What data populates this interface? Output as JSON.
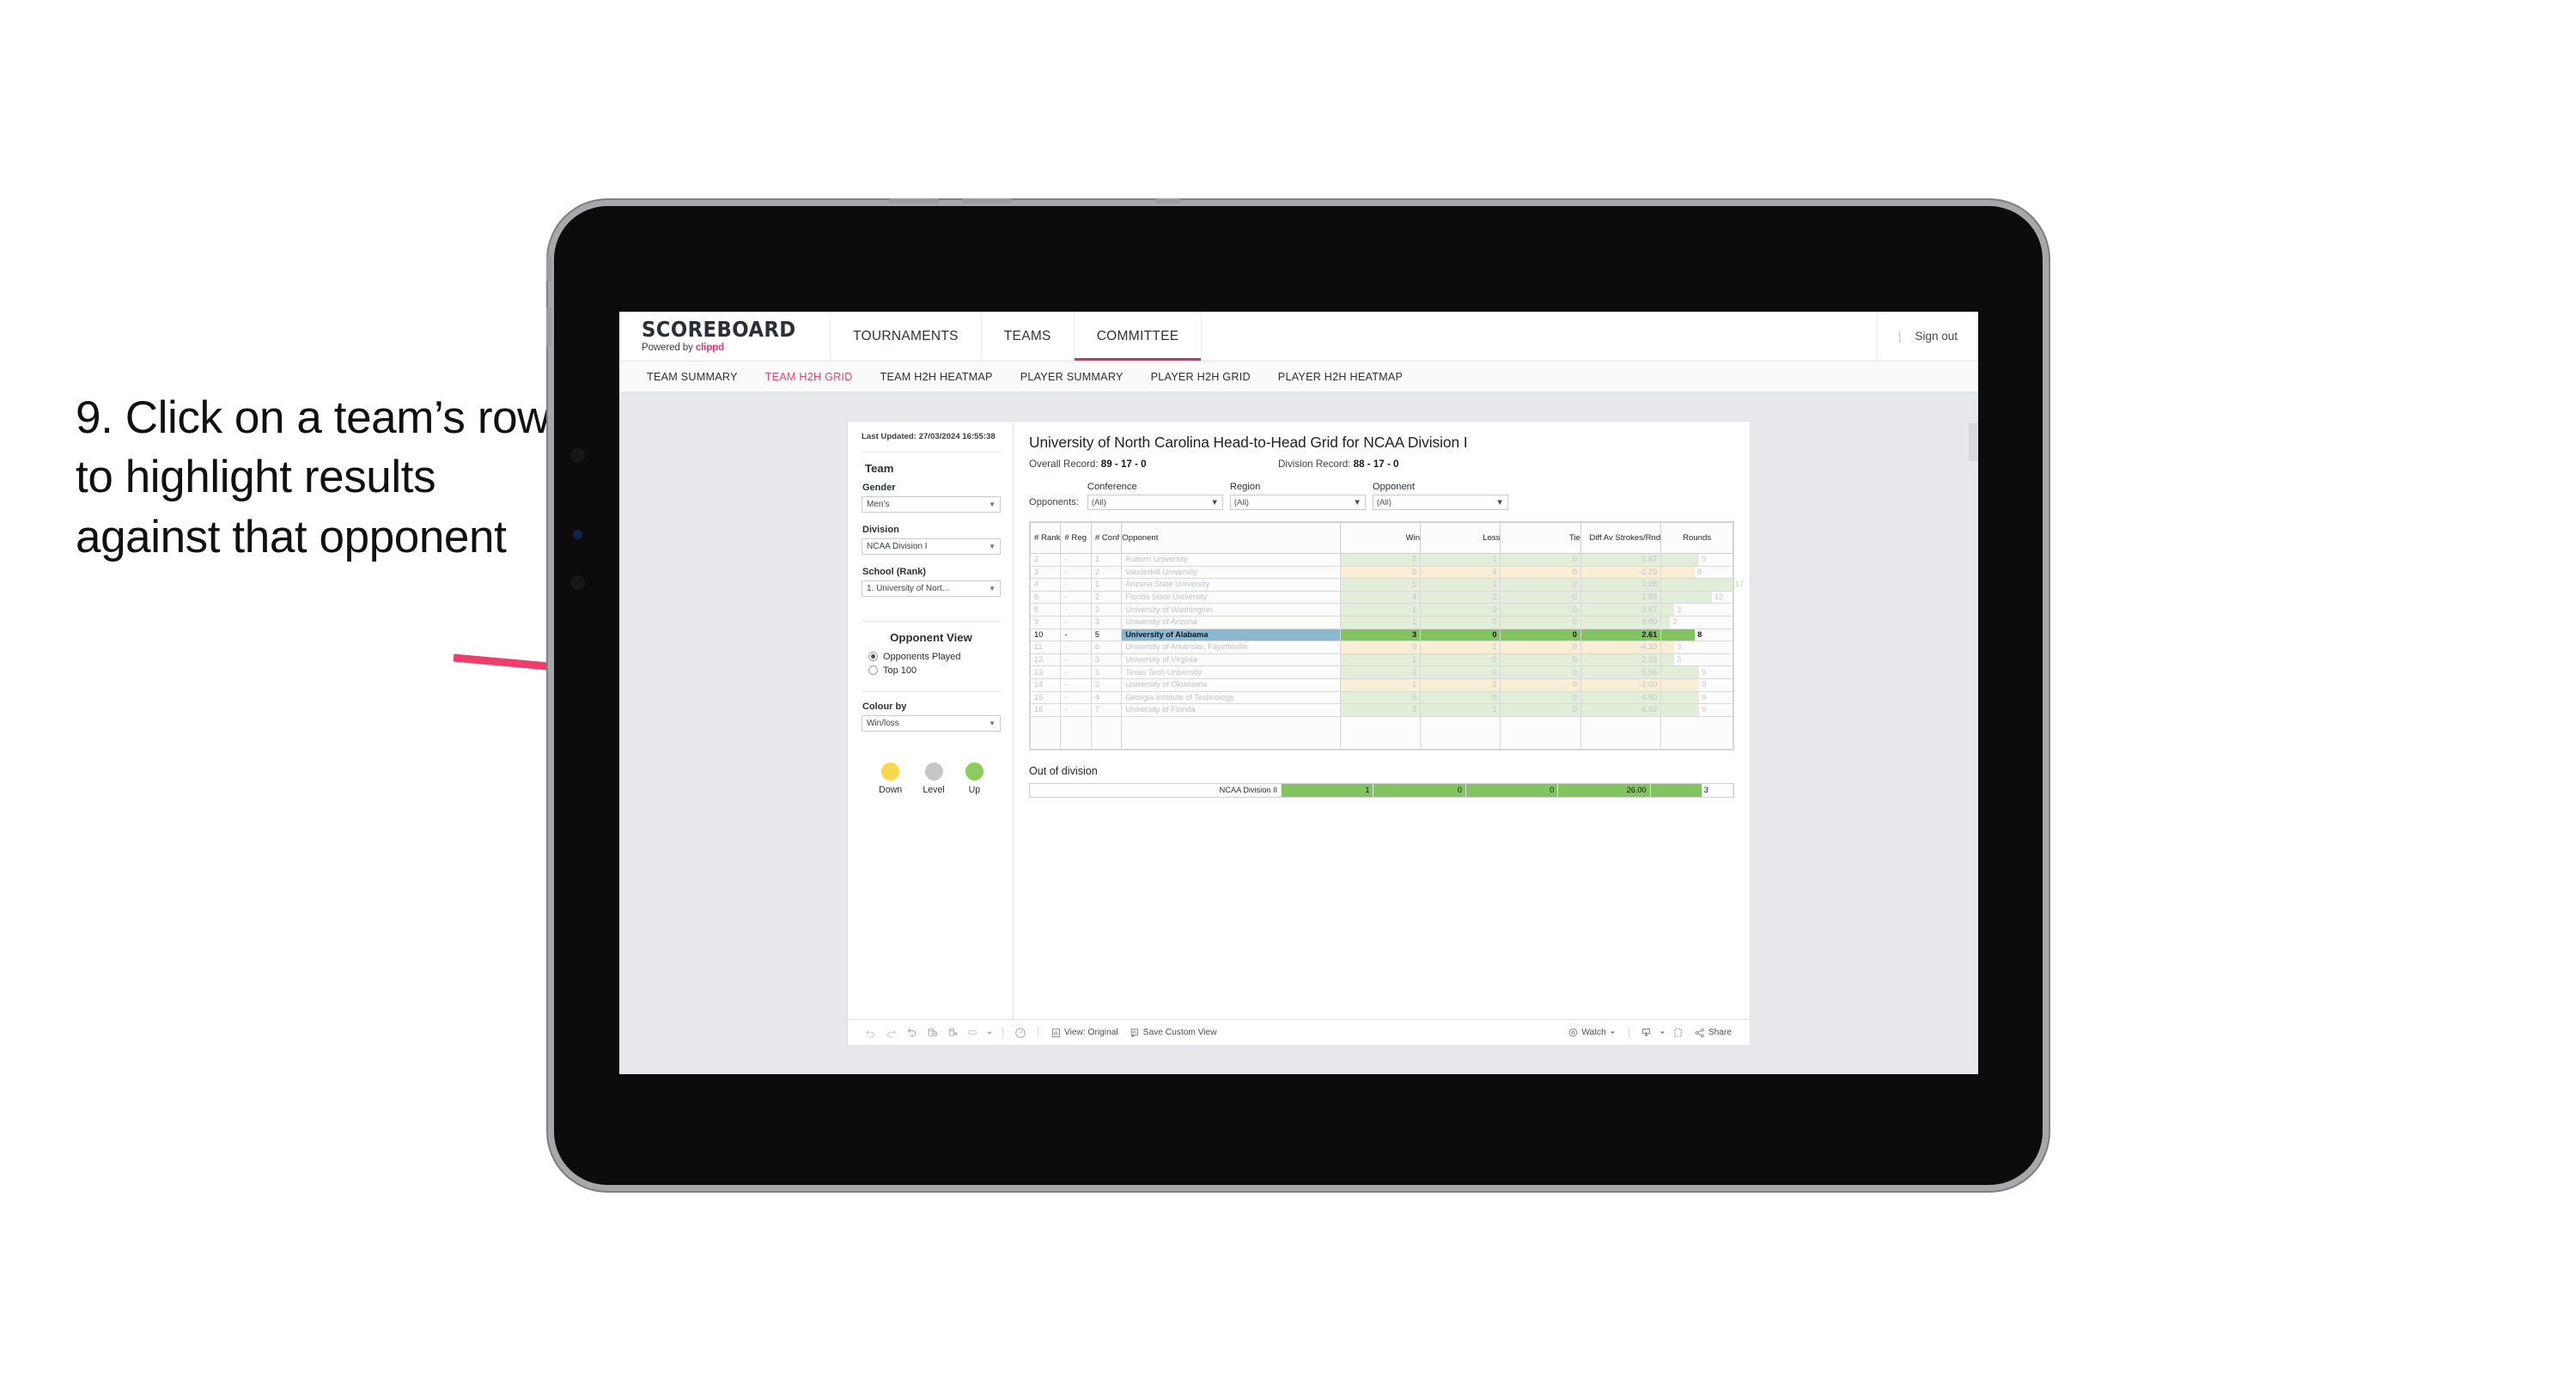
{
  "annotation": {
    "text": "9. Click on a team’s row to highlight results against that opponent",
    "arrow_color": "#ef3e69"
  },
  "header": {
    "brand_title": "SCOREBOARD",
    "brand_sub_prefix": "Powered by ",
    "brand_sub_name": "clippd",
    "nav": [
      {
        "label": "TOURNAMENTS",
        "active": false
      },
      {
        "label": "TEAMS",
        "active": false
      },
      {
        "label": "COMMITTEE",
        "active": true
      }
    ],
    "separator": "|",
    "sign_out": "Sign out"
  },
  "subnav": {
    "tabs": [
      {
        "label": "TEAM SUMMARY",
        "active": false
      },
      {
        "label": "TEAM H2H GRID",
        "active": true
      },
      {
        "label": "TEAM H2H HEATMAP",
        "active": false
      },
      {
        "label": "PLAYER SUMMARY",
        "active": false
      },
      {
        "label": "PLAYER H2H GRID",
        "active": false
      },
      {
        "label": "PLAYER H2H HEATMAP",
        "active": false
      }
    ]
  },
  "sidebar": {
    "last_updated": "Last Updated: 27/03/2024 16:55:38",
    "team_heading": "Team",
    "gender_label": "Gender",
    "gender_value": "Men’s",
    "division_label": "Division",
    "division_value": "NCAA Division I",
    "school_label": "School (Rank)",
    "school_value": "1. University of Nort...",
    "opponent_view_heading": "Opponent View",
    "opponent_view_options": [
      {
        "label": "Opponents Played",
        "selected": true
      },
      {
        "label": "Top 100",
        "selected": false
      }
    ],
    "colour_by_label": "Colour by",
    "colour_by_value": "Win/loss",
    "legend": [
      {
        "label": "Down",
        "color": "#f5d84f"
      },
      {
        "label": "Level",
        "color": "#c4c6c8"
      },
      {
        "label": "Up",
        "color": "#8ccc5e"
      }
    ]
  },
  "content": {
    "title": "University of North Carolina Head-to-Head Grid for NCAA Division I",
    "overall_record_label": "Overall Record: ",
    "overall_record_value": "89 - 17 - 0",
    "division_record_label": "Division Record: ",
    "division_record_value": "88 - 17 - 0",
    "opponents_label": "Opponents:",
    "filters": [
      {
        "label": "Conference",
        "value": "(All)"
      },
      {
        "label": "Region",
        "value": "(All)"
      },
      {
        "label": "Opponent",
        "value": "(All)"
      }
    ],
    "out_of_division_title": "Out of division"
  },
  "chart_data": {
    "type": "table",
    "title": "University of North Carolina Head-to-Head Grid for NCAA Division I",
    "columns": [
      "# Rank",
      "# Reg",
      "# Conf",
      "Opponent",
      "Win",
      "Loss",
      "Tie",
      "Diff Av Strokes/Rnd",
      "Rounds"
    ],
    "rows": [
      {
        "rank": "2",
        "reg": "-",
        "conf": "1",
        "opponent": "Auburn University",
        "win": "2",
        "loss": "1",
        "tie": "0",
        "diff": "1.67",
        "rounds": "9",
        "result": "up",
        "rounds_pct": 53
      },
      {
        "rank": "3",
        "reg": "-",
        "conf": "2",
        "opponent": "Vanderbilt University",
        "win": "0",
        "loss": "4",
        "tie": "0",
        "diff": "-2.29",
        "rounds": "8",
        "result": "down",
        "rounds_pct": 47
      },
      {
        "rank": "4",
        "reg": "-",
        "conf": "1",
        "opponent": "Arizona State University",
        "win": "5",
        "loss": "1",
        "tie": "0",
        "diff": "2.28",
        "rounds": "17",
        "result": "up",
        "rounds_pct": 100
      },
      {
        "rank": "6",
        "reg": "-",
        "conf": "2",
        "opponent": "Florida State University",
        "win": "4",
        "loss": "2",
        "tie": "0",
        "diff": "1.83",
        "rounds": "12",
        "result": "up",
        "rounds_pct": 71
      },
      {
        "rank": "8",
        "reg": "-",
        "conf": "2",
        "opponent": "University of Washington",
        "win": "1",
        "loss": "0",
        "tie": "0",
        "diff": "3.67",
        "rounds": "3",
        "result": "up",
        "rounds_pct": 18
      },
      {
        "rank": "9",
        "reg": "-",
        "conf": "3",
        "opponent": "University of Arizona",
        "win": "1",
        "loss": "0",
        "tie": "0",
        "diff": "9.00",
        "rounds": "2",
        "result": "up",
        "rounds_pct": 12
      },
      {
        "rank": "10",
        "reg": "-",
        "conf": "5",
        "opponent": "University of Alabama",
        "win": "3",
        "loss": "0",
        "tie": "0",
        "diff": "2.61",
        "rounds": "8",
        "result": "selected",
        "rounds_pct": 47
      },
      {
        "rank": "11",
        "reg": "-",
        "conf": "6",
        "opponent": "University of Arkansas, Fayetteville",
        "win": "0",
        "loss": "1",
        "tie": "0",
        "diff": "-4.33",
        "rounds": "3",
        "result": "down",
        "rounds_pct": 18
      },
      {
        "rank": "12",
        "reg": "-",
        "conf": "3",
        "opponent": "University of Virginia",
        "win": "1",
        "loss": "0",
        "tie": "0",
        "diff": "2.33",
        "rounds": "3",
        "result": "up",
        "rounds_pct": 18
      },
      {
        "rank": "13",
        "reg": "-",
        "conf": "1",
        "opponent": "Texas Tech University",
        "win": "3",
        "loss": "0",
        "tie": "0",
        "diff": "5.56",
        "rounds": "9",
        "result": "up",
        "rounds_pct": 53
      },
      {
        "rank": "14",
        "reg": "-",
        "conf": "2",
        "opponent": "University of Oklahoma",
        "win": "1",
        "loss": "2",
        "tie": "0",
        "diff": "-1.00",
        "rounds": "9",
        "result": "down",
        "rounds_pct": 53
      },
      {
        "rank": "15",
        "reg": "-",
        "conf": "4",
        "opponent": "Georgia Institute of Technology",
        "win": "5",
        "loss": "0",
        "tie": "0",
        "diff": "4.50",
        "rounds": "9",
        "result": "up",
        "rounds_pct": 53
      },
      {
        "rank": "16",
        "reg": "-",
        "conf": "7",
        "opponent": "University of Florida",
        "win": "3",
        "loss": "1",
        "tie": "0",
        "diff": "6.62",
        "rounds": "9",
        "result": "up",
        "rounds_pct": 53
      }
    ],
    "out_of_division": [
      {
        "opponent": "NCAA Division II",
        "win": "1",
        "loss": "0",
        "tie": "0",
        "diff": "26.00",
        "rounds": "3"
      }
    ],
    "selected_row_index": 6,
    "colors": {
      "up": "#e2edda",
      "down": "#f8eed5",
      "selected_green": "#82c45f",
      "selected_blue": "#8ab8d1"
    }
  },
  "toolbar": {
    "view_label": "View: Original",
    "save_label": "Save Custom View",
    "watch_label": "Watch",
    "share_label": "Share"
  }
}
